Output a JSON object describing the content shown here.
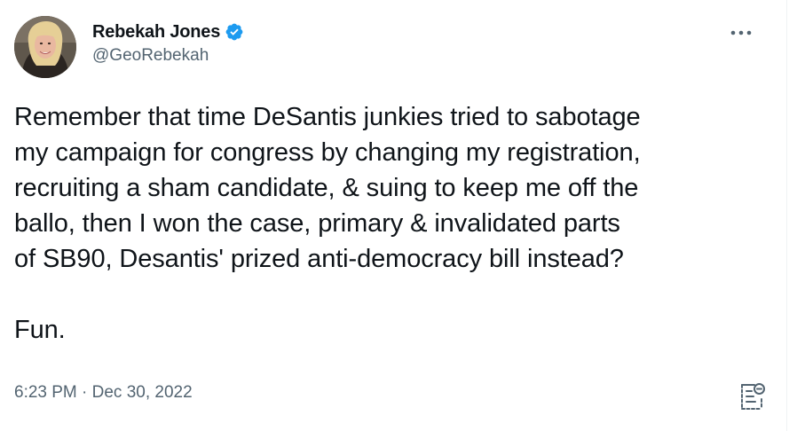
{
  "author": {
    "display_name": "Rebekah Jones",
    "handle": "@GeoRebekah",
    "verified": true,
    "avatar_icon": "profile-photo"
  },
  "menu": {
    "icon": "more-horizontal-icon"
  },
  "tweet": {
    "text": "Remember that time DeSantis junkies tried to sabotage\nmy campaign for congress by changing my registration,\nrecruiting a sham candidate, & suing to keep me off the\nballo, then I won the case, primary & invalidated parts\nof SB90, Desantis' prized anti-democracy bill instead?\n\nFun.",
    "timestamp": "6:23 PM · Dec 30, 2022"
  },
  "actions": {
    "view_activity_icon": "tweet-activity-icon"
  },
  "colors": {
    "text": "#0f1419",
    "secondary": "#536471",
    "verified_blue": "#1d9bf0"
  }
}
